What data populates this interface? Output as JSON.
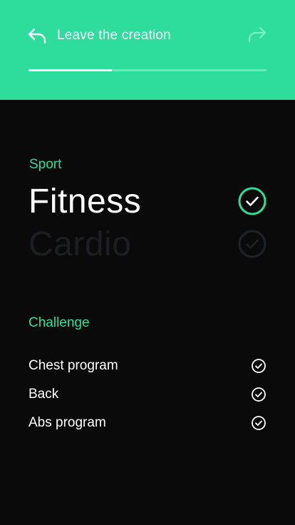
{
  "header": {
    "back_label": "Leave the creation",
    "progress_fraction": 0.35,
    "bg_color": "#2edc9b"
  },
  "sport": {
    "label": "Sport",
    "options": [
      {
        "name": "Fitness",
        "selected": true
      },
      {
        "name": "Cardio",
        "selected": false
      }
    ]
  },
  "challenge": {
    "label": "Challenge",
    "items": [
      {
        "name": "Chest program",
        "checked": true
      },
      {
        "name": "Back",
        "checked": true
      },
      {
        "name": "Abs program",
        "checked": true
      }
    ]
  },
  "icons": {
    "back": "undo-arrow-icon",
    "forward": "redo-arrow-icon",
    "check": "check-circle-icon"
  },
  "colors": {
    "accent": "#2edc9b",
    "background": "#0a0a0a",
    "muted": "#1c1e22"
  }
}
